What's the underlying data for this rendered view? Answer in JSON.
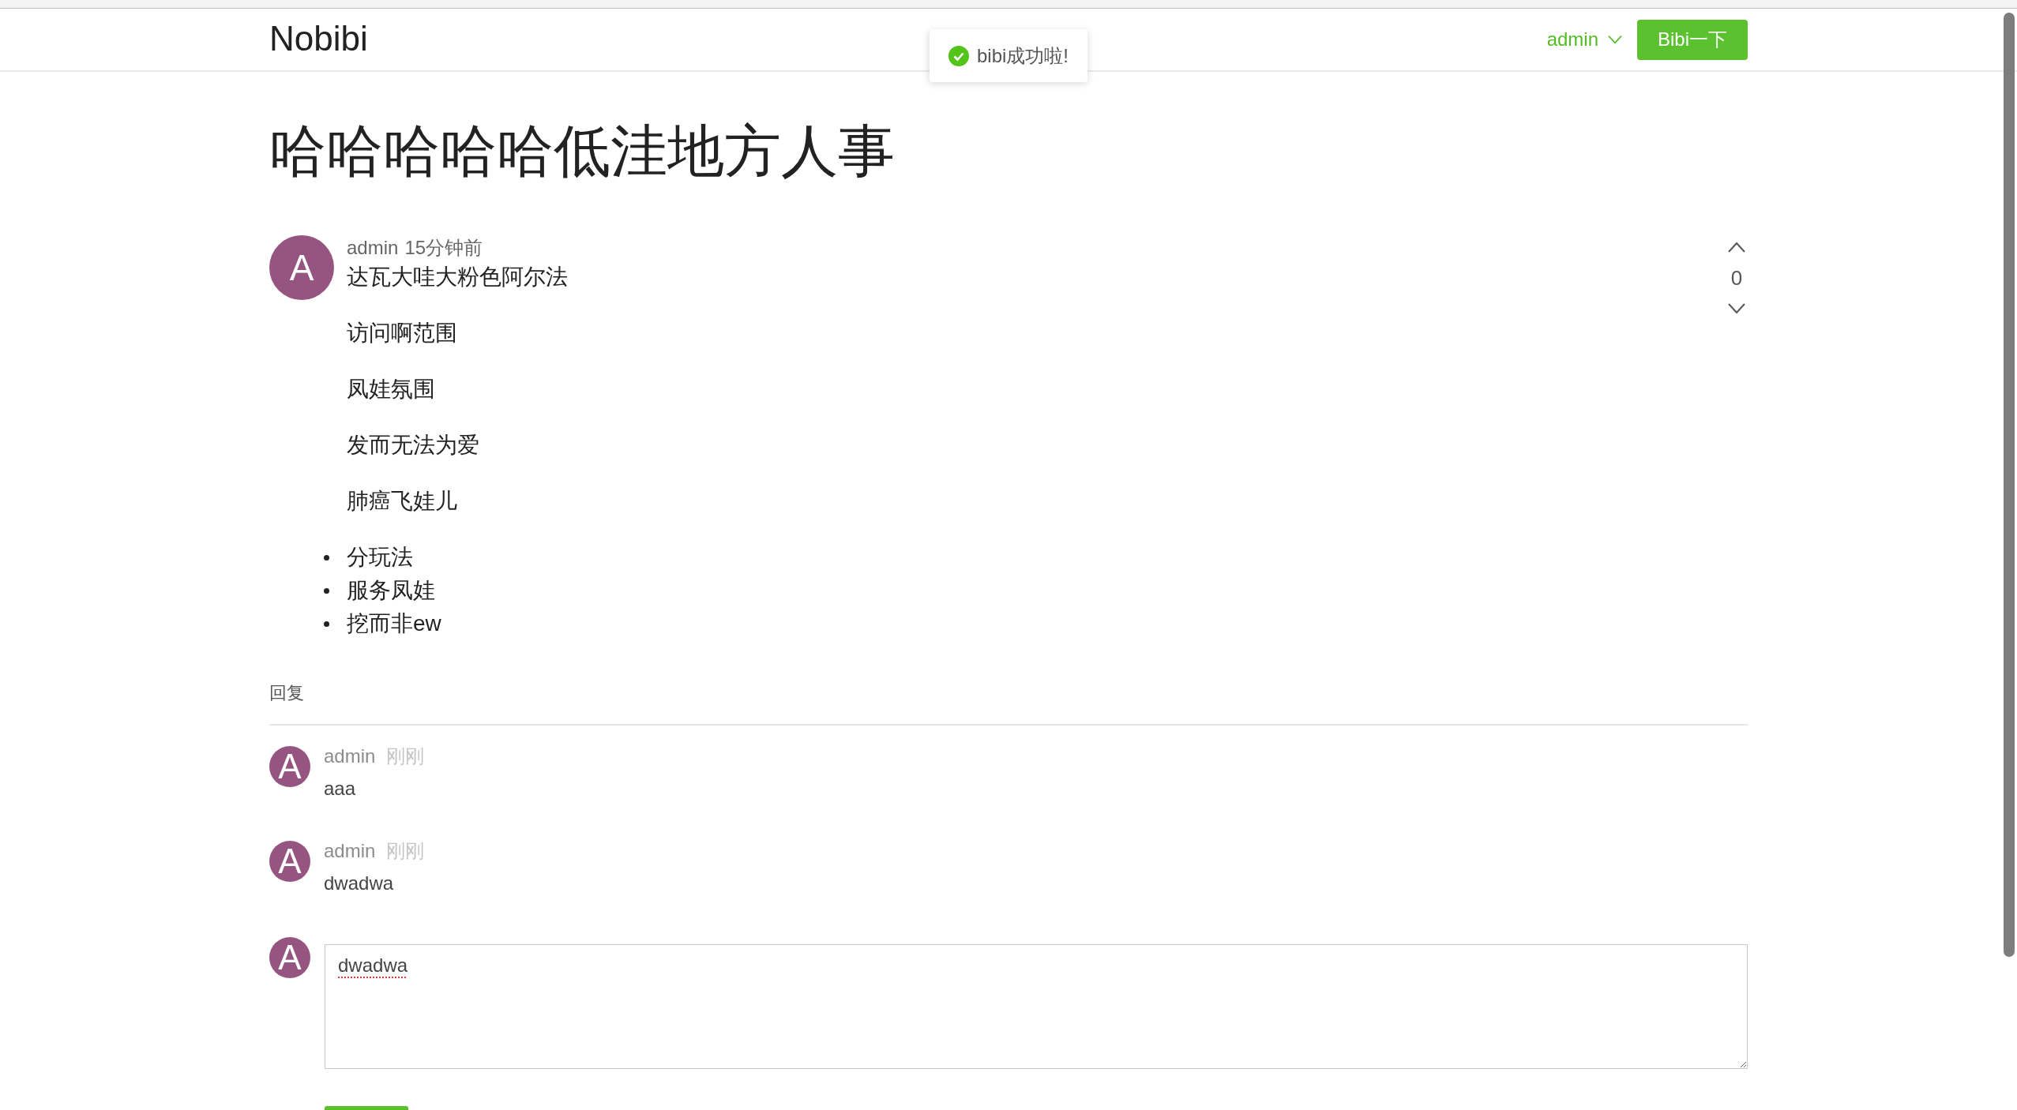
{
  "header": {
    "logo": "Nobibi",
    "user_menu": "admin",
    "post_button": "Bibi一下"
  },
  "toast": {
    "message": "bibi成功啦!"
  },
  "post": {
    "title": "哈哈哈哈哈低洼地方人事",
    "avatar": "A",
    "author": "admin",
    "time": "15分钟前",
    "body": [
      {
        "kind": "paragraph",
        "text": "达瓦大哇大粉色阿尔法"
      },
      {
        "kind": "paragraph",
        "text": "访问啊范围"
      },
      {
        "kind": "paragraph",
        "text": "凤娃氛围"
      },
      {
        "kind": "paragraph",
        "text": "发而无法为爱"
      },
      {
        "kind": "paragraph",
        "text": "肺癌飞娃儿"
      },
      {
        "kind": "list",
        "items": [
          "分玩法",
          "服务凤娃",
          "挖而非ew"
        ]
      }
    ],
    "votes": "0"
  },
  "replies": {
    "heading": "回复",
    "items": [
      {
        "avatar": "A",
        "author": "admin",
        "time": "刚刚",
        "text": "aaa"
      },
      {
        "avatar": "A",
        "author": "admin",
        "time": "刚刚",
        "text": "dwadwa"
      }
    ]
  },
  "compose": {
    "avatar": "A",
    "value": "dwadwa"
  }
}
